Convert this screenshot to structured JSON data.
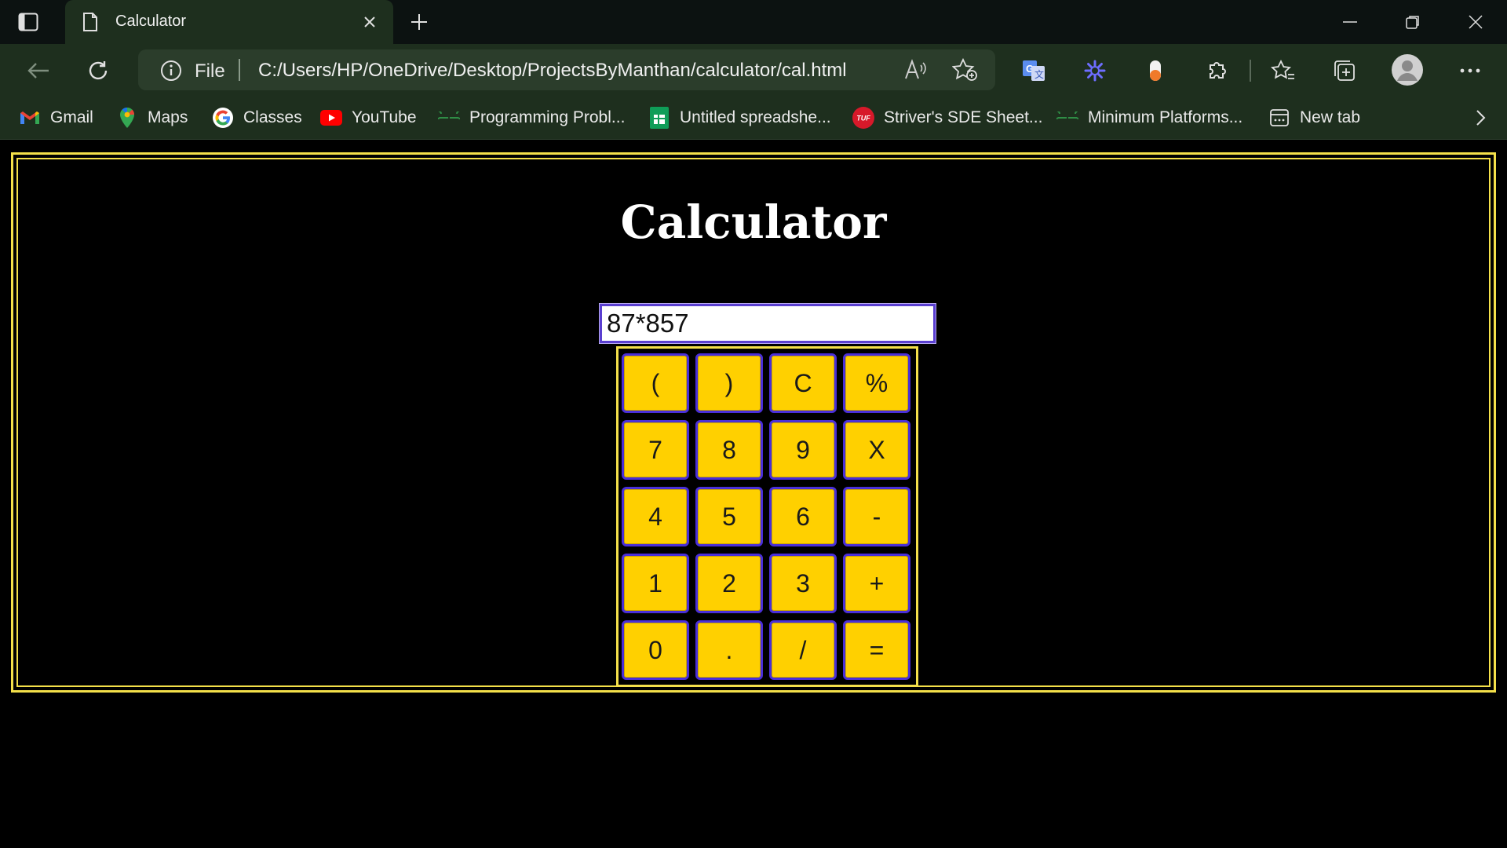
{
  "browser": {
    "tab_title": "Calculator",
    "address": {
      "scheme_label": "File",
      "url": "C:/Users/HP/OneDrive/Desktop/ProjectsByManthan/calculator/cal.html"
    },
    "bookmarks": [
      {
        "label": "Gmail",
        "icon": "gmail-icon"
      },
      {
        "label": "Maps",
        "icon": "maps-icon"
      },
      {
        "label": "Classes",
        "icon": "google-icon"
      },
      {
        "label": "YouTube",
        "icon": "youtube-icon"
      },
      {
        "label": "Programming Probl...",
        "icon": "geeksforgeeks-icon"
      },
      {
        "label": "Untitled spreadshe...",
        "icon": "sheets-icon"
      },
      {
        "label": "Striver's SDE Sheet...",
        "icon": "tuf-icon"
      },
      {
        "label": "Minimum Platforms...",
        "icon": "geeksforgeeks-icon"
      },
      {
        "label": "New tab",
        "icon": "newtab-icon"
      }
    ],
    "tuf_badge_text": "TUF",
    "colors": {
      "chrome_bg": "#1e2f1e",
      "tabstrip_bg": "#0c1211"
    }
  },
  "page": {
    "heading": "Calculator",
    "display_value": "87*857",
    "keys": [
      "(",
      ")",
      "C",
      "%",
      "7",
      "8",
      "9",
      "X",
      "4",
      "5",
      "6",
      "-",
      "1",
      "2",
      "3",
      "+",
      "0",
      ".",
      "/",
      "="
    ],
    "colors": {
      "key_bg": "#ffd000",
      "key_border": "#4a2fd8",
      "frame": "#f4e04a",
      "background": "#000000"
    }
  }
}
